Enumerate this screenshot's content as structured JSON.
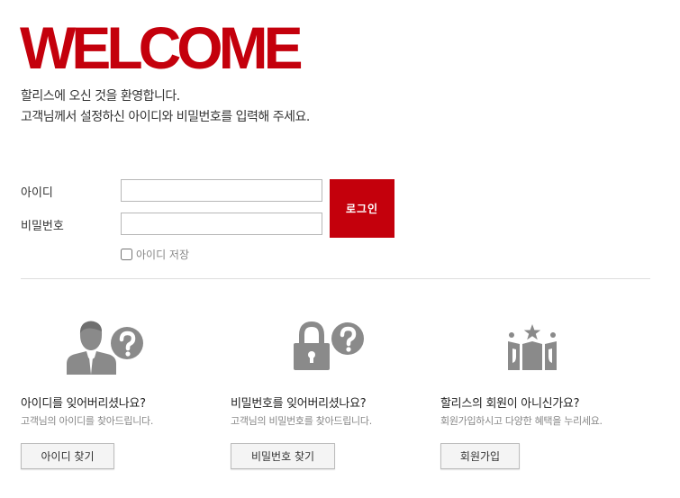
{
  "welcome": "WELCOME",
  "intro": {
    "line1": "할리스에 오신 것을 환영합니다.",
    "line2": "고객님께서 설정하신 아이디와 비밀번호를 입력해 주세요."
  },
  "login": {
    "id_label": "아이디",
    "pw_label": "비밀번호",
    "id_value": "",
    "pw_value": "",
    "button": "로그인",
    "save_id": "아이디 저장"
  },
  "help": [
    {
      "question": "아이디를 잊어버리셨나요?",
      "desc": "고객님의 아이디를 찾아드립니다.",
      "button": "아이디 찾기",
      "icon": "user-question-icon"
    },
    {
      "question": "비밀번호를 잊어버리셨나요?",
      "desc": "고객님의 비밀번호를 찾아드립니다.",
      "button": "비밀번호 찾기",
      "icon": "lock-question-icon"
    },
    {
      "question": "할리스의 회원이 아니신가요?",
      "desc": "회원가입하시고 다양한 혜택을 누리세요.",
      "button": "회원가입",
      "icon": "membership-icon"
    }
  ],
  "colors": {
    "brand": "#c4000c",
    "icon": "#8a8a8a"
  }
}
